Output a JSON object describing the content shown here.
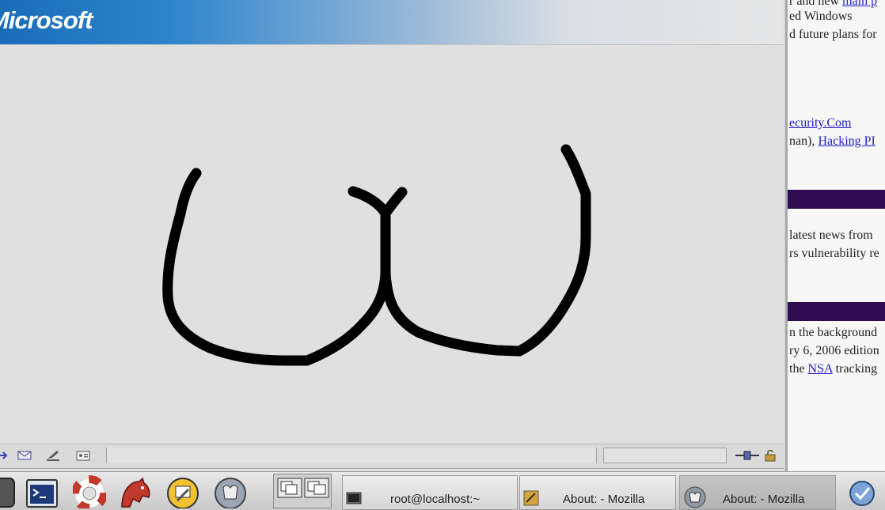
{
  "main_window": {
    "banner_logo": "Microsoft",
    "drawing": "hand-drawn curved black stroke"
  },
  "background_page": {
    "lines": [
      {
        "text": "r and new ",
        "link": "main p"
      },
      {
        "text": "ed Windows"
      },
      {
        "text": "d future plans for"
      },
      {
        "text": "",
        "link": "ecurity.Com"
      },
      {
        "text": "nan), ",
        "link": "Hacking PI"
      },
      {
        "text": "latest news from"
      },
      {
        "text": "rs vulnerability re"
      },
      {
        "text": "n the background"
      },
      {
        "text": "ry 6, 2006 edition"
      },
      {
        "text": " the ",
        "link": "NSA",
        "after": " tracking"
      }
    ],
    "link_color": "#2222cc",
    "bar_color": "#2e0c52"
  },
  "taskbar": {
    "tasks": [
      {
        "label": "root@localhost:~",
        "icon": "terminal-icon"
      },
      {
        "label": "About: - Mozilla",
        "icon": "mozilla-icon"
      },
      {
        "label": "About: - Mozilla",
        "icon": "gnu-icon"
      }
    ],
    "launchers": [
      "terminal-launcher-icon",
      "help-lifebuoy-icon",
      "mozilla-launcher-icon",
      "gnome-tools-icon",
      "gnu-icon"
    ]
  }
}
